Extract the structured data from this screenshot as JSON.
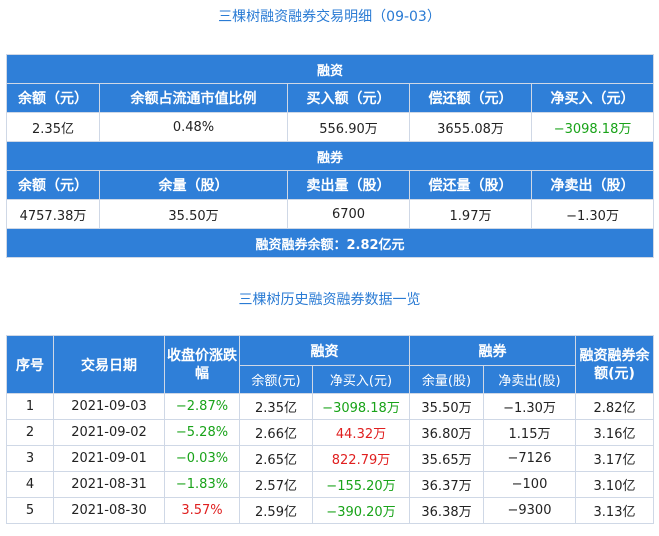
{
  "title_top": "三棵树融资融券交易明细（09-03）",
  "margin_financing": {
    "band": "融资",
    "headers": [
      "余额（元）",
      "余额占流通市值比例",
      "买入额（元）",
      "偿还额（元）",
      "净买入（元）"
    ],
    "values": [
      "2.35亿",
      "0.48%",
      "556.90万",
      "3655.08万",
      "−3098.18万"
    ]
  },
  "securities_lending": {
    "band": "融券",
    "headers": [
      "余额（元）",
      "余量（股）",
      "卖出量（股）",
      "偿还量（股）",
      "净卖出（股）"
    ],
    "values": [
      "4757.38万",
      "35.50万",
      "6700",
      "1.97万",
      "−1.30万"
    ]
  },
  "total": "融资融券余额：2.82亿元",
  "title_history": "三棵树历史融资融券数据一览",
  "history": {
    "headers": {
      "seq": "序号",
      "date": "交易日期",
      "change": "收盘价涨跌幅",
      "fin_group": "融资",
      "fin_balance": "余额(元)",
      "fin_net_buy": "净买入(元)",
      "lend_group": "融券",
      "lend_volume": "余量(股)",
      "lend_net_sell": "净卖出(股)",
      "total_balance": "融资融券余额(元)"
    },
    "rows": [
      {
        "seq": "1",
        "date": "2021-09-03",
        "change": "−2.87%",
        "fin_balance": "2.35亿",
        "fin_net_buy": "−3098.18万",
        "lend_volume": "35.50万",
        "lend_net_sell": "−1.30万",
        "total": "2.82亿"
      },
      {
        "seq": "2",
        "date": "2021-09-02",
        "change": "−5.28%",
        "fin_balance": "2.66亿",
        "fin_net_buy": "44.32万",
        "lend_volume": "36.80万",
        "lend_net_sell": "1.15万",
        "total": "3.16亿"
      },
      {
        "seq": "3",
        "date": "2021-09-01",
        "change": "−0.03%",
        "fin_balance": "2.65亿",
        "fin_net_buy": "822.79万",
        "lend_volume": "35.65万",
        "lend_net_sell": "−7126",
        "total": "3.17亿"
      },
      {
        "seq": "4",
        "date": "2021-08-31",
        "change": "−1.83%",
        "fin_balance": "2.57亿",
        "fin_net_buy": "−155.20万",
        "lend_volume": "36.37万",
        "lend_net_sell": "−100",
        "total": "3.10亿"
      },
      {
        "seq": "5",
        "date": "2021-08-30",
        "change": "3.57%",
        "fin_balance": "2.59亿",
        "fin_net_buy": "−390.20万",
        "lend_volume": "36.38万",
        "lend_net_sell": "−9300",
        "total": "3.13亿"
      }
    ]
  },
  "colors": {
    "accent": "#2f7fd8",
    "down": "#19a319",
    "up": "#e02020"
  }
}
